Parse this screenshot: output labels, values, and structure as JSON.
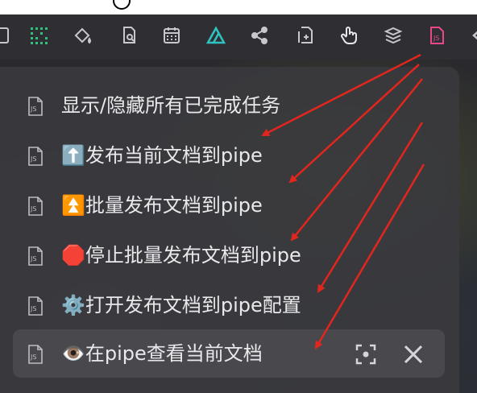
{
  "colors": {
    "accent_green": "#2ec27e",
    "js_pink": "#e8478b",
    "arrow_red": "#e3261d"
  },
  "toolbar": {
    "icons": [
      "book-icon",
      "grid-dots-icon",
      "paint-bucket-icon",
      "document-search-icon",
      "calendar-icon",
      "excalidraw-icon",
      "share-icon",
      "add-document-icon",
      "hand-pointer-icon",
      "stack-icon",
      "js-file-icon",
      "chevron-left-icon"
    ]
  },
  "commands": {
    "items": [
      {
        "label": "显示/隐藏所有已完成任务"
      },
      {
        "label": "⬆️发布当前文档到pipe"
      },
      {
        "label": "⏫批量发布文档到pipe"
      },
      {
        "label": "🛑停止批量发布文档到pipe"
      },
      {
        "label": "⚙️打开发布文档到pipe配置"
      },
      {
        "label": "👁️在pipe查看当前文档"
      }
    ]
  }
}
